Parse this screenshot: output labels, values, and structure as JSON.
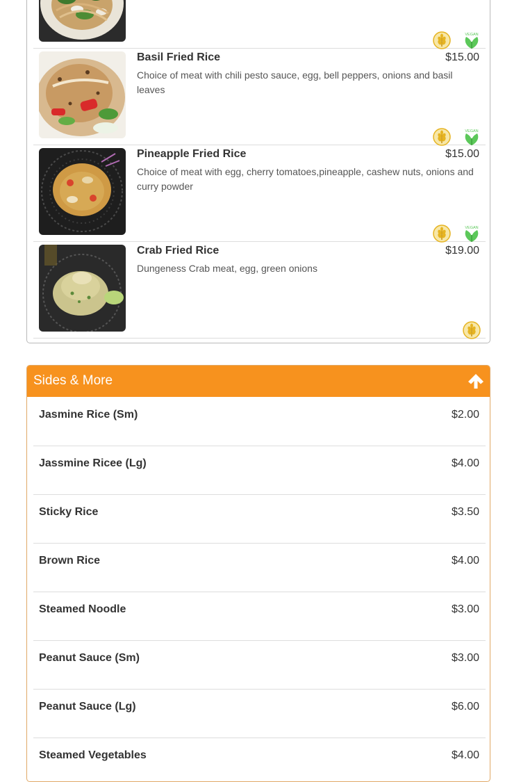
{
  "fried_rice_section": {
    "dishes": [
      {
        "name": "",
        "price": "",
        "description": "",
        "image_icon": "stir-fry-noodle-photo",
        "badges": [
          "gluten-free-icon",
          "vegan-icon"
        ]
      },
      {
        "name": "Basil Fried Rice",
        "price": "$15.00",
        "description": "Choice of meat with chili pesto sauce, egg, bell peppers, onions and basil leaves",
        "image_icon": "basil-fried-rice-photo",
        "badges": [
          "gluten-free-icon",
          "vegan-icon"
        ]
      },
      {
        "name": "Pineapple Fried Rice",
        "price": "$15.00",
        "description": "Choice of meat with egg, cherry tomatoes,pineapple, cashew nuts, onions and curry powder",
        "image_icon": "pineapple-fried-rice-photo",
        "badges": [
          "gluten-free-icon",
          "vegan-icon"
        ]
      },
      {
        "name": "Crab Fried Rice",
        "price": "$19.00",
        "description": "Dungeness Crab meat, egg, green onions",
        "image_icon": "crab-fried-rice-photo",
        "badges": [
          "gluten-free-icon"
        ]
      }
    ],
    "badge_labels": {
      "vegan": "VEGAN"
    }
  },
  "sides_section": {
    "title": "Sides & More",
    "collapse_icon": "arrow-up-icon",
    "items": [
      {
        "name": "Jasmine Rice (Sm)",
        "price": "$2.00"
      },
      {
        "name": "Jassmine Ricee (Lg)",
        "price": "$4.00"
      },
      {
        "name": "Sticky Rice",
        "price": "$3.50"
      },
      {
        "name": "Brown Rice",
        "price": "$4.00"
      },
      {
        "name": "Steamed Noodle",
        "price": "$3.00"
      },
      {
        "name": "Peanut Sauce (Sm)",
        "price": "$3.00"
      },
      {
        "name": "Peanut Sauce (Lg)",
        "price": "$6.00"
      },
      {
        "name": "Steamed Vegetables",
        "price": "$4.00"
      }
    ]
  },
  "colors": {
    "header_orange": "#f7921e",
    "border_gray": "#b9b9b9",
    "vegan_green": "#5cc85a",
    "gluten_gold": "#e6b422"
  }
}
